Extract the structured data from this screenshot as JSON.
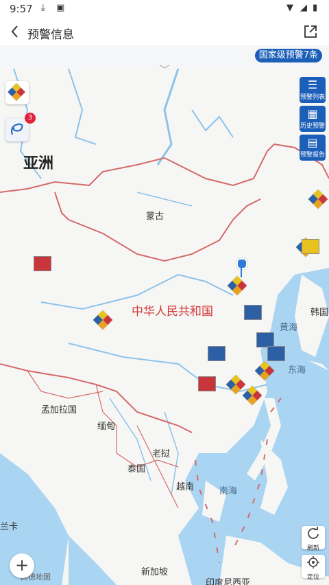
{
  "status": {
    "time": "9:57",
    "download_icon": "download-icon",
    "app_icon": "app-notification-icon"
  },
  "header": {
    "title": "预警信息",
    "back_icon": "chevron-left-icon",
    "share_icon": "share-icon"
  },
  "banner": {
    "national_warnings": "国家级预警7条"
  },
  "side_buttons": [
    {
      "label": "预警列表",
      "icon": "list-icon"
    },
    {
      "label": "历史预警",
      "icon": "calendar-icon"
    },
    {
      "label": "预警报告",
      "icon": "report-icon"
    }
  ],
  "left_icons": {
    "badge": "3"
  },
  "map": {
    "labels": {
      "asia": "亚洲",
      "mongolia": "蒙古",
      "china": "中华人民共和国",
      "yellow_sea": "黄海",
      "korea": "韩国",
      "east_sea": "东海",
      "bangladesh": "孟加拉国",
      "myanmar": "缅甸",
      "laos": "老挝",
      "thailand": "泰国",
      "vietnam": "越南",
      "south_sea": "南海",
      "srilanka": "兰卡",
      "singapore": "新加坡",
      "indonesia": "印度尼西亚",
      "provider": "高德地图"
    }
  },
  "controls": {
    "refresh": "刷新",
    "locate": "定位",
    "zoom_in": "+"
  },
  "colors": {
    "primary": "#1c5fb8",
    "water": "#a9d4f2",
    "border": "#d46a6a",
    "warning_red": "#c8353b",
    "badge_red": "#e0223a"
  }
}
